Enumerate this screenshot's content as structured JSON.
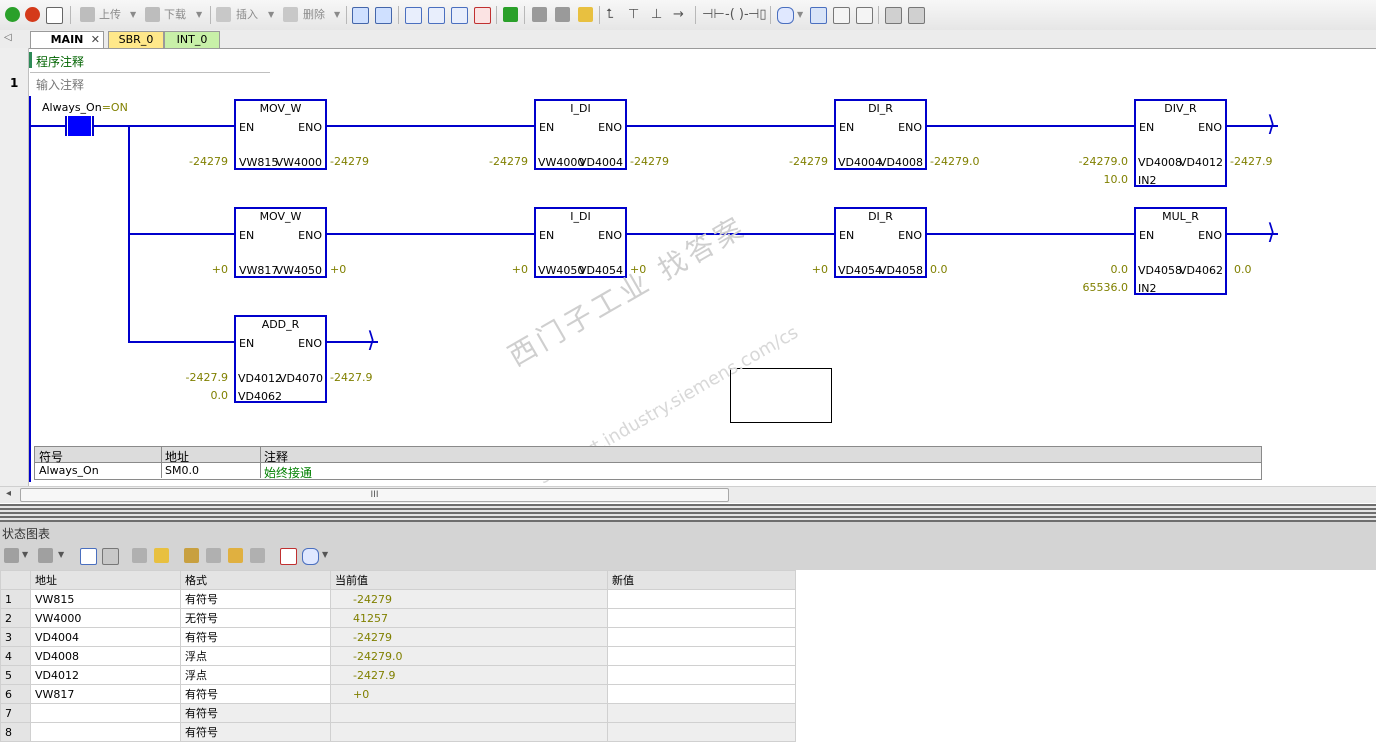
{
  "toolbar": {
    "upload_label": "上传",
    "download_label": "下载",
    "insert_label": "插入",
    "delete_label": "删除"
  },
  "tabs": [
    "MAIN",
    "SBR_0",
    "INT_0"
  ],
  "program_comment": "程序注释",
  "network": {
    "number": "1",
    "comment": "输入注释",
    "contact": {
      "label": "Always_On",
      "state": "=ON"
    },
    "boxes": [
      {
        "title": "MOV_W",
        "en": "EN",
        "eno": "ENO",
        "in1_addr": "VW815",
        "out_addr": "VW4000",
        "in1_val": "-24279",
        "out_val": "-24279"
      },
      {
        "title": "I_DI",
        "en": "EN",
        "eno": "ENO",
        "in1_addr": "VW4000",
        "out_addr": "VD4004",
        "in1_val": "-24279",
        "out_val": "-24279"
      },
      {
        "title": "DI_R",
        "en": "EN",
        "eno": "ENO",
        "in1_addr": "VD4004",
        "out_addr": "VD4008",
        "in1_val": "-24279",
        "out_val": "-24279.0"
      },
      {
        "title": "DIV_R",
        "en": "EN",
        "eno": "ENO",
        "in1_addr": "VD4008",
        "out_addr": "VD4012",
        "in1_val": "-24279.0",
        "out_val": "-2427.9",
        "in2_addr": "IN2",
        "in2_val": "10.0"
      },
      {
        "title": "MOV_W",
        "en": "EN",
        "eno": "ENO",
        "in1_addr": "VW817",
        "out_addr": "VW4050",
        "in1_val": "+0",
        "out_val": "+0"
      },
      {
        "title": "I_DI",
        "en": "EN",
        "eno": "ENO",
        "in1_addr": "VW4050",
        "out_addr": "VD4054",
        "in1_val": "+0",
        "out_val": "+0"
      },
      {
        "title": "DI_R",
        "en": "EN",
        "eno": "ENO",
        "in1_addr": "VD4054",
        "out_addr": "VD4058",
        "in1_val": "+0",
        "out_val": "0.0"
      },
      {
        "title": "MUL_R",
        "en": "EN",
        "eno": "ENO",
        "in1_addr": "VD4058",
        "out_addr": "VD4062",
        "in1_val": "0.0",
        "out_val": "0.0",
        "in2_addr": "IN2",
        "in2_val": "65536.0"
      },
      {
        "title": "ADD_R",
        "en": "EN",
        "eno": "ENO",
        "in1_addr": "VD4012",
        "out_addr": "VD4070",
        "in1_val": "-2427.9",
        "out_val": "-2427.9",
        "in2_addr": "VD4062",
        "in2_val": "0.0"
      }
    ]
  },
  "symbol_table": {
    "headers": [
      "符号",
      "地址",
      "注释"
    ],
    "rows": [
      {
        "symbol": "Always_On",
        "address": "SM0.0",
        "comment": "始终接通"
      }
    ]
  },
  "scroll_grip": "III",
  "watermark": {
    "text": "西门子工业  找答案",
    "url": "support.industry.siemens.com/cs"
  },
  "status_chart": {
    "title": "状态图表",
    "headers": [
      "",
      "地址",
      "格式",
      "当前值",
      "新值"
    ],
    "rows": [
      {
        "num": "1",
        "address": "VW815",
        "format": "有符号",
        "value": "-24279",
        "new": ""
      },
      {
        "num": "2",
        "address": "VW4000",
        "format": "无符号",
        "value": "41257",
        "new": ""
      },
      {
        "num": "3",
        "address": "VD4004",
        "format": "有符号",
        "value": "-24279",
        "new": ""
      },
      {
        "num": "4",
        "address": "VD4008",
        "format": "浮点",
        "value": "-24279.0",
        "new": ""
      },
      {
        "num": "5",
        "address": "VD4012",
        "format": "浮点",
        "value": "-2427.9",
        "new": ""
      },
      {
        "num": "6",
        "address": "VW817",
        "format": "有符号",
        "value": "+0",
        "new": ""
      },
      {
        "num": "7",
        "address": "",
        "format": "有符号",
        "value": "",
        "new": ""
      },
      {
        "num": "8",
        "address": "",
        "format": "有符号",
        "value": "",
        "new": ""
      }
    ]
  }
}
